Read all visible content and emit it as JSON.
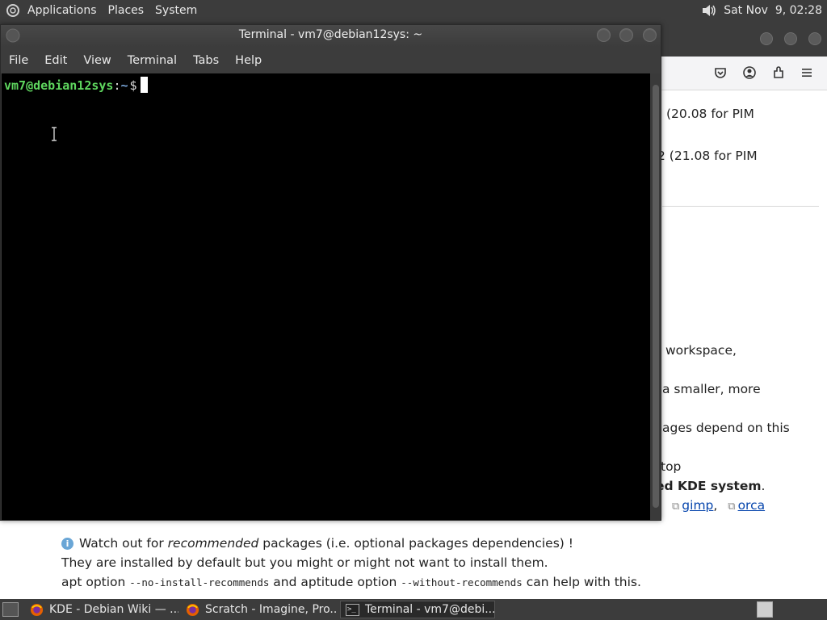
{
  "top_panel": {
    "menus": [
      "Applications",
      "Places",
      "System"
    ],
    "clock": "Sat Nov  9, 02:28"
  },
  "browser": {
    "toolbar_icons": [
      "pocket-icon",
      "account-icon",
      "extensions-icon",
      "menu-icon"
    ],
    "content": {
      "line1": "(20.08 for PIM",
      "line2": "2 (21.08 for PIM",
      "line3": "workspace,",
      "line4": "a smaller, more",
      "line5": "ages depend on this",
      "line6": "top",
      "line7_bold": "ed KDE system",
      "line7_tail": ".",
      "pkg_gimp": "gimp",
      "pkg_sep": ",",
      "pkg_orca": "orca",
      "note_pre": "Watch out for ",
      "note_em": "recommended",
      "note_post": " packages (i.e. optional packages dependencies) !",
      "note_line2": "They are installed by default but you might or might not want to install them.",
      "note_line3_a": "apt option ",
      "note_line3_code1": "--no-install-recommends",
      "note_line3_b": " and aptitude option ",
      "note_line3_code2": "--without-recommends",
      "note_line3_c": " can help with this."
    }
  },
  "terminal": {
    "title": "Terminal - vm7@debian12sys: ~",
    "menus": [
      "File",
      "Edit",
      "View",
      "Terminal",
      "Tabs",
      "Help"
    ],
    "prompt_user": "vm7@debian12sys",
    "prompt_sep": ":",
    "prompt_path": "~",
    "prompt_dollar": "$"
  },
  "taskbar": {
    "tasks": [
      {
        "label": "KDE - Debian Wiki — ...",
        "icon": "firefox-icon"
      },
      {
        "label": "Scratch - Imagine, Pro...",
        "icon": "firefox-icon"
      },
      {
        "label": "Terminal - vm7@debi...",
        "icon": "terminal-icon"
      }
    ]
  },
  "colors": {
    "prompt_user": "#5fd75f",
    "prompt_path": "#7aa6da",
    "link": "#0645ad",
    "panel_bg": "#3c3c3c"
  }
}
